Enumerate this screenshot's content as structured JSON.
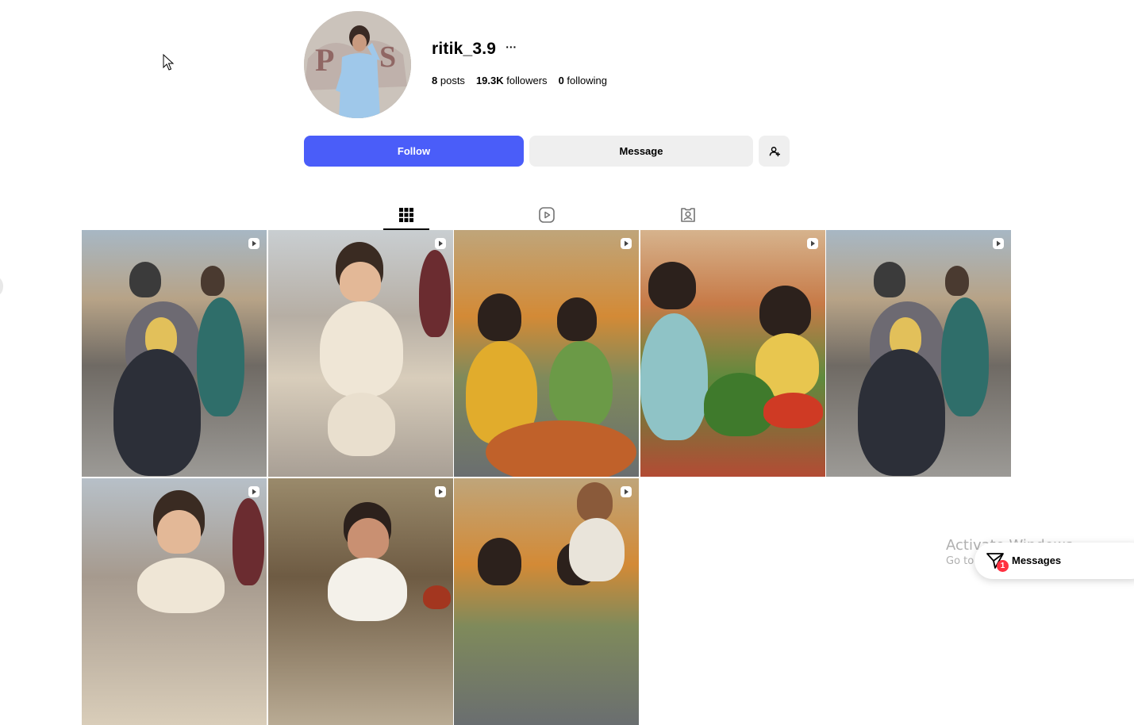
{
  "profile": {
    "username": "ritik_3.9",
    "more_label": "···",
    "stats": [
      {
        "value": "8",
        "label": "posts"
      },
      {
        "value": "19.3K",
        "label": "followers"
      },
      {
        "value": "0",
        "label": "following"
      }
    ]
  },
  "actions": {
    "follow_label": "Follow",
    "message_label": "Message",
    "add_icon": "add-person-icon"
  },
  "tabs": [
    {
      "name": "posts",
      "icon": "grid-icon",
      "active": true
    },
    {
      "name": "reels",
      "icon": "reels-icon",
      "active": false
    },
    {
      "name": "tagged",
      "icon": "tagged-icon",
      "active": false
    }
  ],
  "posts": [
    {
      "type": "reel"
    },
    {
      "type": "reel"
    },
    {
      "type": "reel"
    },
    {
      "type": "reel"
    },
    {
      "type": "reel"
    },
    {
      "type": "reel"
    },
    {
      "type": "reel"
    },
    {
      "type": "reel"
    }
  ],
  "watermark": {
    "line1": "Activate Windows",
    "line2": "Go to Settings to activate Windows."
  },
  "messages": {
    "label": "Messages",
    "badge": "1"
  },
  "colors": {
    "accent": "#4a5df9",
    "secondary_button": "#efefef",
    "badge": "#ff3040"
  }
}
